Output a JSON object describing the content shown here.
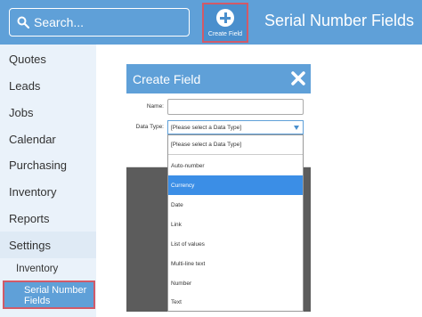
{
  "header": {
    "search_placeholder": "Search...",
    "create_field_label": "Create Field",
    "page_title": "Serial Number Fields"
  },
  "sidebar": {
    "items": [
      {
        "label": "Quotes"
      },
      {
        "label": "Leads"
      },
      {
        "label": "Jobs"
      },
      {
        "label": "Calendar"
      },
      {
        "label": "Purchasing"
      },
      {
        "label": "Inventory"
      },
      {
        "label": "Reports"
      },
      {
        "label": "Settings"
      }
    ],
    "sub_items": [
      {
        "label": "Inventory"
      },
      {
        "label": "Serial Number Fields"
      }
    ]
  },
  "modal": {
    "title": "Create Field",
    "name_label": "Name:",
    "name_value": "",
    "data_type_label": "Data Type:",
    "data_type_value": "[Please select a Data Type]",
    "options": [
      "[Please select a Data Type]",
      "Auto-number",
      "Currency",
      "Date",
      "Link",
      "List of values",
      "Multi-line text",
      "Number",
      "Text"
    ],
    "highlighted_option": "Currency"
  },
  "colors": {
    "accent": "#5fa0d8",
    "highlight_border": "#d25a68",
    "selected_option": "#3b8ee6",
    "overlay": "#5c5c5c"
  }
}
